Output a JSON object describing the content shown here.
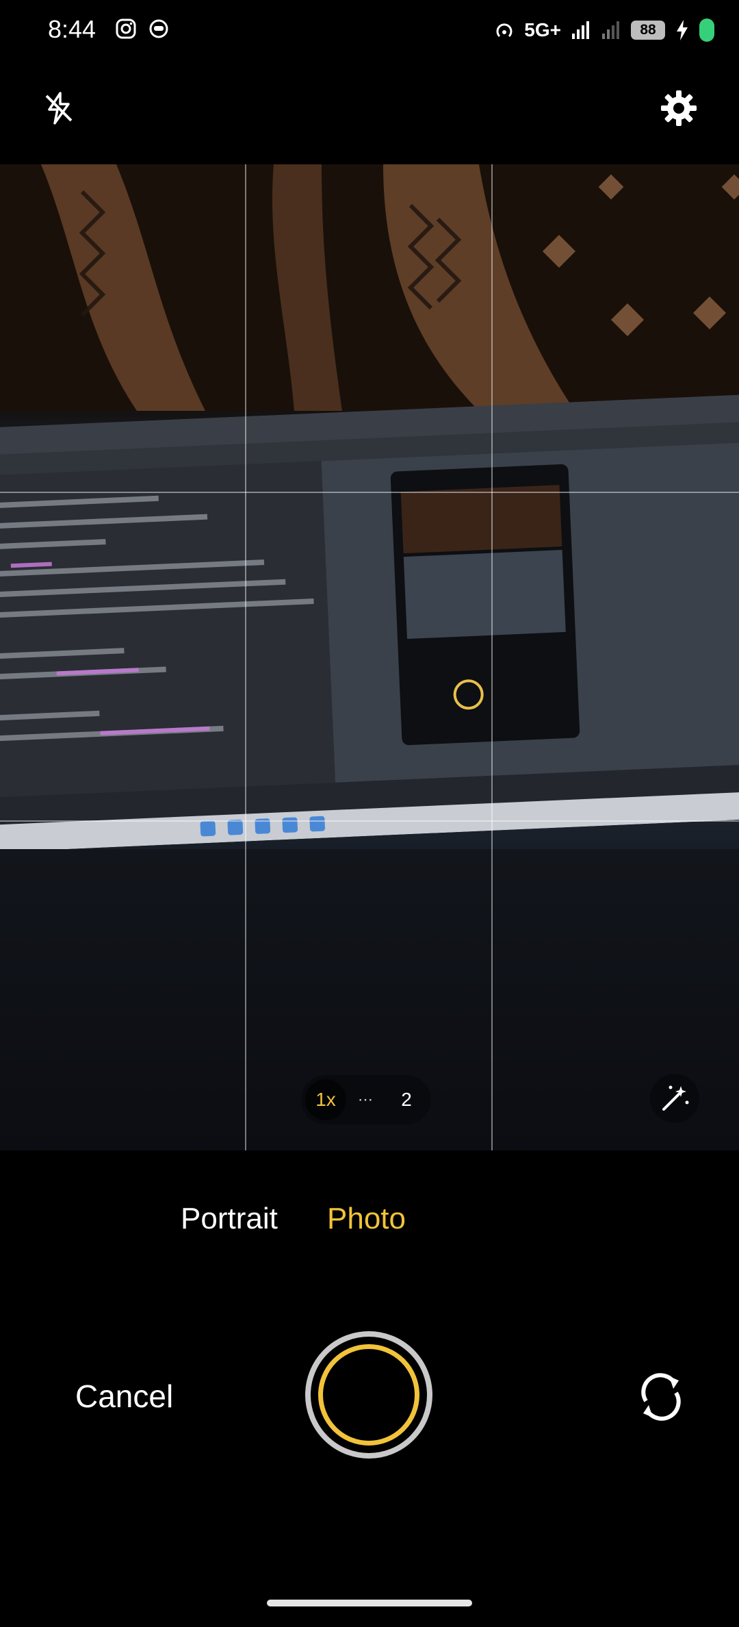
{
  "status_bar": {
    "time": "8:44",
    "network": "5G+",
    "battery": "88"
  },
  "top_controls": {
    "flash_icon": "flash-off-icon",
    "settings_icon": "gear-icon"
  },
  "viewfinder": {
    "zoom_levels": [
      "1x",
      "2"
    ],
    "zoom_selected": "1x",
    "zoom_more": "⋯",
    "magic_icon": "magic-wand-icon"
  },
  "modes": {
    "portrait": "Portrait",
    "photo": "Photo",
    "selected": "Photo"
  },
  "bottom_controls": {
    "cancel_label": "Cancel",
    "shutter_icon": "shutter-button",
    "flip_icon": "switch-camera-icon"
  },
  "colors": {
    "accent": "#f2c33a",
    "background": "#000000",
    "charging": "#36d07a"
  }
}
